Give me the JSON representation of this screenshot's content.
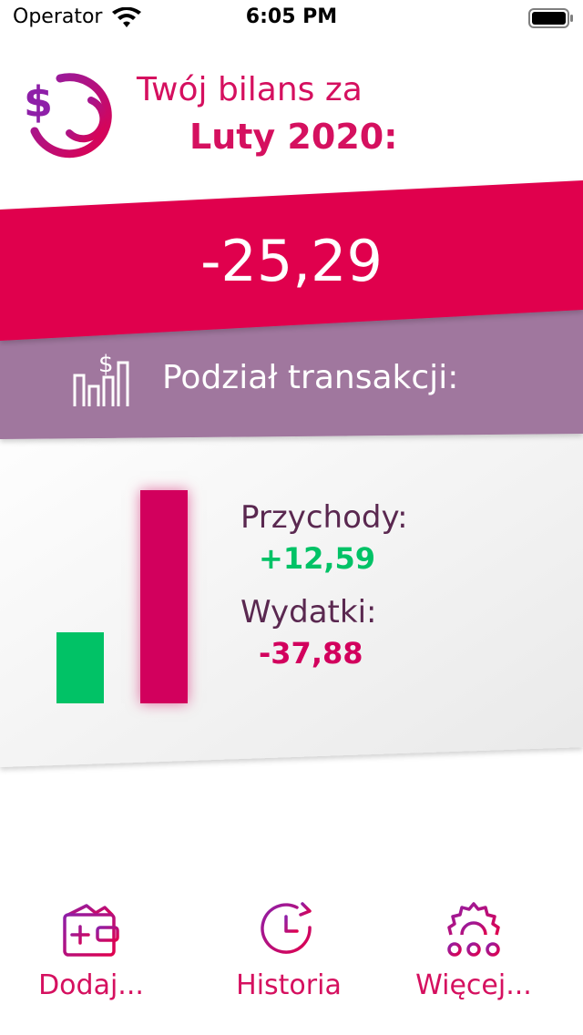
{
  "status_bar": {
    "carrier": "Operator",
    "time": "6:05 PM"
  },
  "header": {
    "title_line1": "Twój bilans za",
    "title_line2": "Luty 2020:"
  },
  "balance": {
    "value": "-25,29"
  },
  "breakdown": {
    "title": "Podział transakcji:"
  },
  "summary": {
    "income_label": "Przychody:",
    "income_value": "+12,59",
    "expense_label": "Wydatki:",
    "expense_value": "-37,88"
  },
  "chart_data": {
    "type": "bar",
    "categories": [
      "Przychody",
      "Wydatki"
    ],
    "values": [
      12.59,
      37.88
    ],
    "colors": [
      "#01c266",
      "#d2005d"
    ],
    "title": "",
    "xlabel": "",
    "ylabel": ""
  },
  "nav": {
    "items": [
      {
        "label": "Dodaj...",
        "icon": "wallet-add-icon"
      },
      {
        "label": "Historia",
        "icon": "history-clock-icon"
      },
      {
        "label": "Więcej...",
        "icon": "gear-more-icon"
      }
    ]
  },
  "colors": {
    "accent": "#d5105f",
    "balance_band": "#e0004d",
    "breakdown_band": "#a0779e",
    "income": "#01c266",
    "expense": "#d2005d",
    "label_text": "#5a2850"
  }
}
